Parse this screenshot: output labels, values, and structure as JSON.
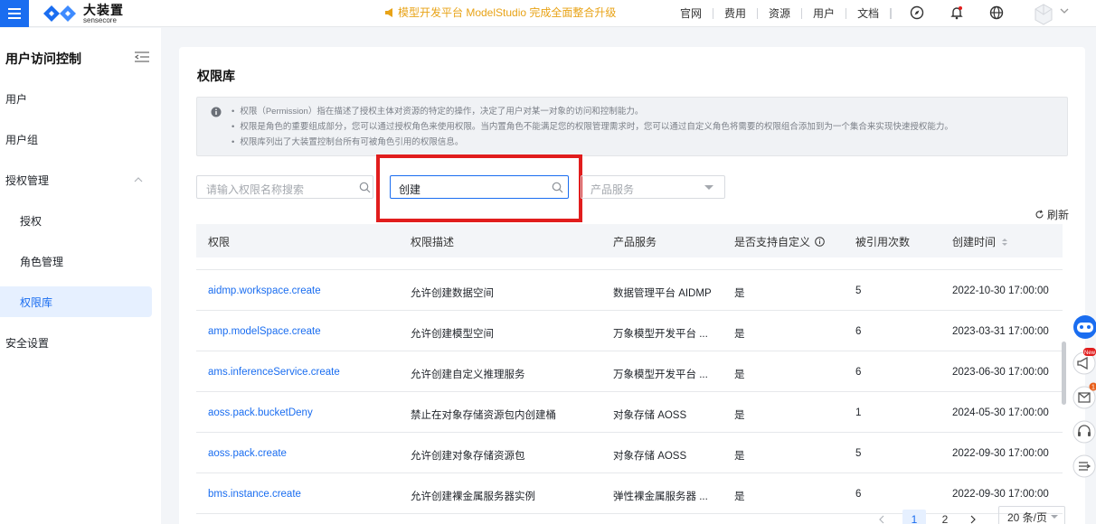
{
  "topbar": {
    "logo_cn": "大装置",
    "logo_en": "sensecore",
    "announcement": "模型开发平台 ModelStudio 完成全面整合升级",
    "nav": [
      "官网",
      "费用",
      "资源",
      "用户",
      "文档"
    ],
    "icons": [
      "compass-icon",
      "bell-icon",
      "globe-icon"
    ]
  },
  "sidebar": {
    "title": "用户访问控制",
    "items": [
      {
        "label": "用户"
      },
      {
        "label": "用户组"
      },
      {
        "label": "授权管理"
      },
      {
        "label": "授权"
      },
      {
        "label": "角色管理"
      },
      {
        "label": "权限库"
      },
      {
        "label": "安全设置"
      }
    ]
  },
  "main": {
    "title": "权限库",
    "notice": [
      "权限（Permission）指在描述了授权主体对资源的特定的操作，决定了用户对某一对象的访问和控制能力。",
      "权限是角色的重要组成部分，您可以通过授权角色来使用权限。当内置角色不能满足您的权限管理需求时，您可以通过自定义角色将需要的权限组合添加到为一个集合来实现快速授权能力。",
      "权限库列出了大装置控制台所有可被角色引用的权限信息。"
    ],
    "search_name_placeholder": "请输入权限名称搜索",
    "search_desc_value": "创建",
    "product_placeholder": "产品服务",
    "refresh_label": "刷新"
  },
  "table": {
    "columns": [
      "权限",
      "权限描述",
      "产品服务",
      "是否支持自定义",
      "被引用次数",
      "创建时间"
    ],
    "rows": [
      [
        "aidmp.workspace.create",
        "允许创建数据空间",
        "数据管理平台 AIDMP",
        "是",
        "5",
        "2022-10-30 17:00:00"
      ],
      [
        "amp.modelSpace.create",
        "允许创建模型空间",
        "万象模型开发平台 ...",
        "是",
        "6",
        "2023-03-31 17:00:00"
      ],
      [
        "ams.inferenceService.create",
        "允许创建自定义推理服务",
        "万象模型开发平台 ...",
        "是",
        "6",
        "2023-06-30 17:00:00"
      ],
      [
        "aoss.pack.bucketDeny",
        "禁止在对象存储资源包内创建桶",
        "对象存储 AOSS",
        "是",
        "1",
        "2024-05-30 17:00:00"
      ],
      [
        "aoss.pack.create",
        "允许创建对象存储资源包",
        "对象存储 AOSS",
        "是",
        "5",
        "2022-09-30 17:00:00"
      ],
      [
        "bms.instance.create",
        "允许创建裸金属服务器实例",
        "弹性裸金属服务器 ...",
        "是",
        "6",
        "2022-09-30 17:00:00"
      ]
    ]
  },
  "pagination": {
    "pages": [
      "1",
      "2"
    ],
    "current": "1",
    "page_size": "20 条/页"
  },
  "float_badges": {
    "badge1": "New",
    "badge2": "1"
  },
  "colors": {
    "accent": "#1a6df0",
    "highlight": "#e11d1d",
    "announcement": "#e8a317"
  }
}
